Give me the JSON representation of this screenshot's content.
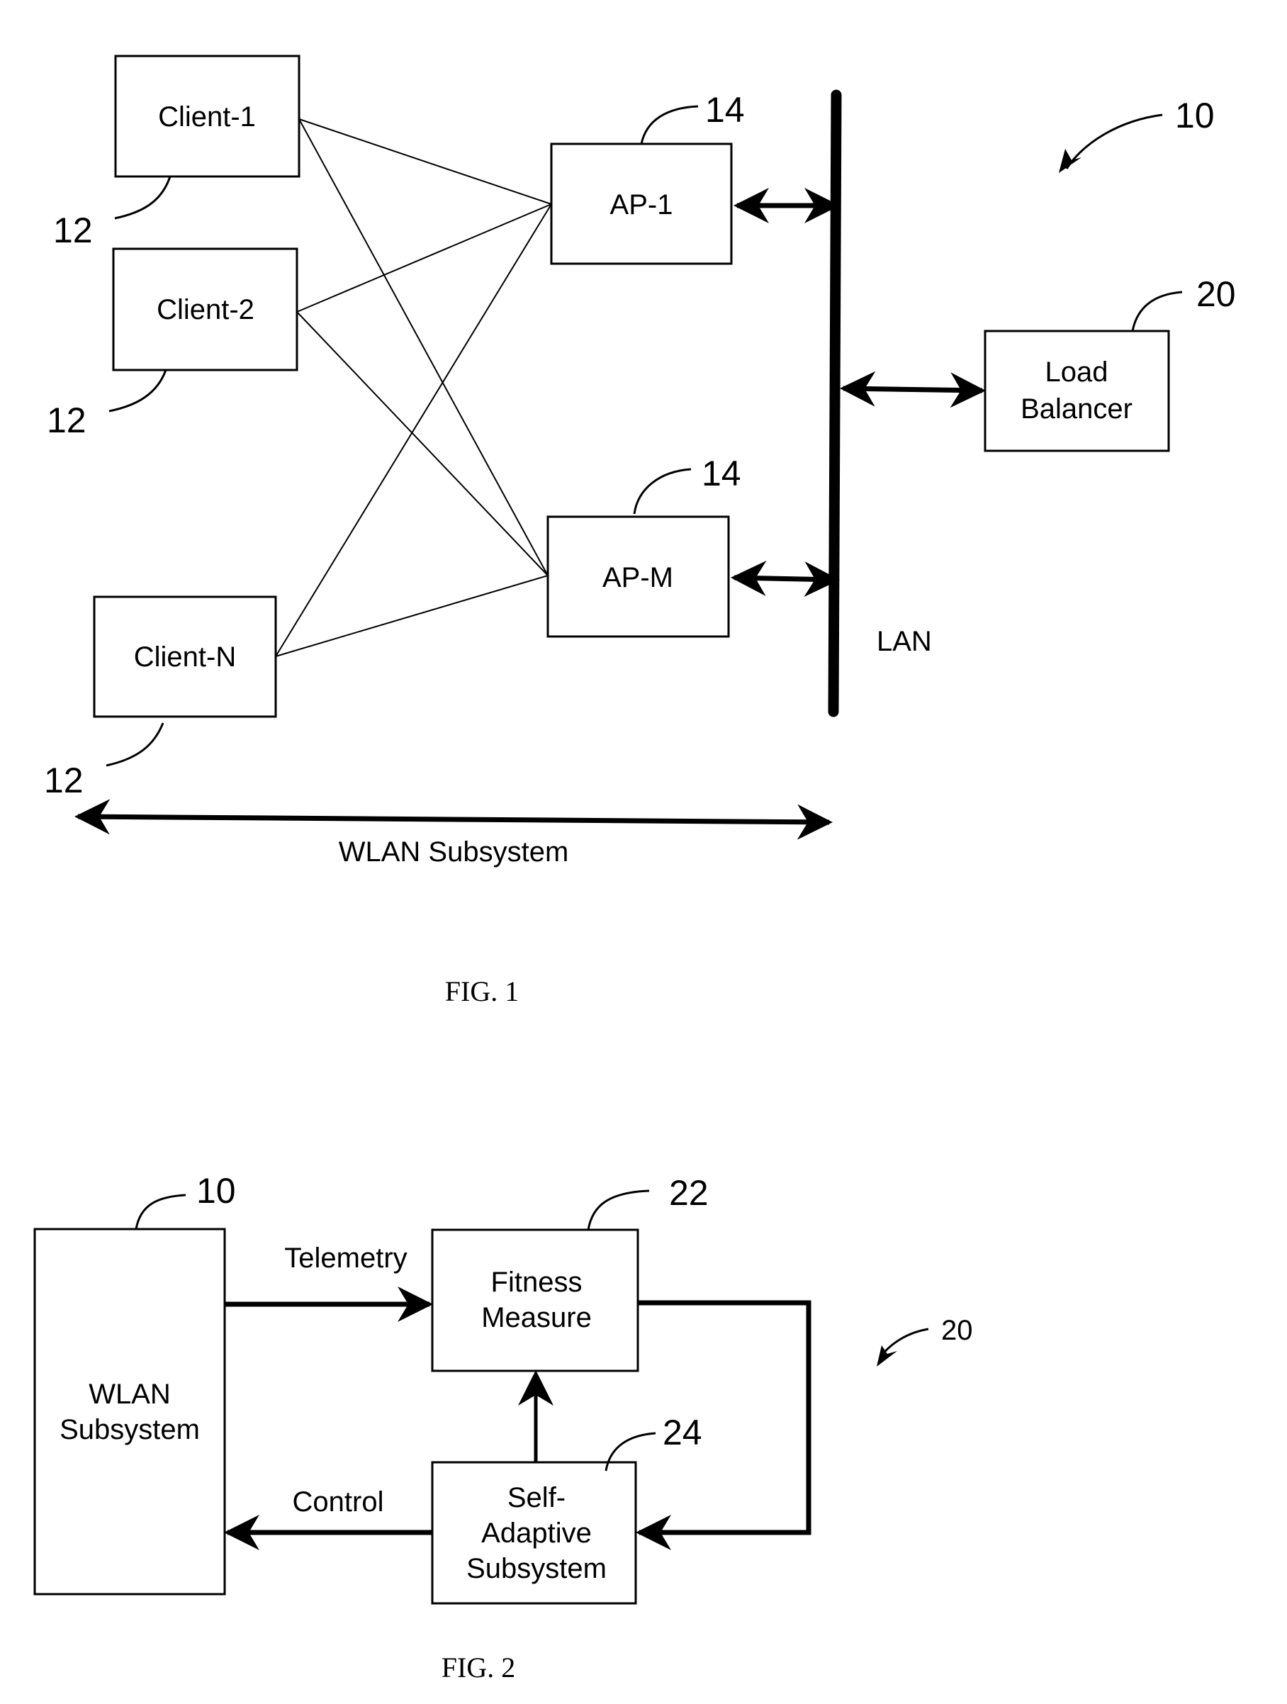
{
  "fig1": {
    "caption": "FIG. 1",
    "system_ref": "10",
    "clients": [
      {
        "label": "Client-1",
        "ref": "12"
      },
      {
        "label": "Client-2",
        "ref": "12"
      },
      {
        "label": "Client-N",
        "ref": "12"
      }
    ],
    "access_points": [
      {
        "label": "AP-1",
        "ref": "14"
      },
      {
        "label": "AP-M",
        "ref": "14"
      }
    ],
    "load_balancer": {
      "label_line1": "Load",
      "label_line2": "Balancer",
      "ref": "20"
    },
    "lan_label": "LAN",
    "wlan_span_label": "WLAN Subsystem"
  },
  "fig2": {
    "caption": "FIG. 2",
    "system_ref": "20",
    "wlan_box": {
      "label_line1": "WLAN",
      "label_line2": "Subsystem",
      "ref": "10"
    },
    "fitness_box": {
      "label_line1": "Fitness",
      "label_line2": "Measure",
      "ref": "22"
    },
    "adaptive_box": {
      "label_line1": "Self-",
      "label_line2": "Adaptive",
      "label_line3": "Subsystem",
      "ref": "24"
    },
    "telemetry_label": "Telemetry",
    "control_label": "Control"
  },
  "colors": {
    "ink": "#000000",
    "paper": "#ffffff"
  }
}
